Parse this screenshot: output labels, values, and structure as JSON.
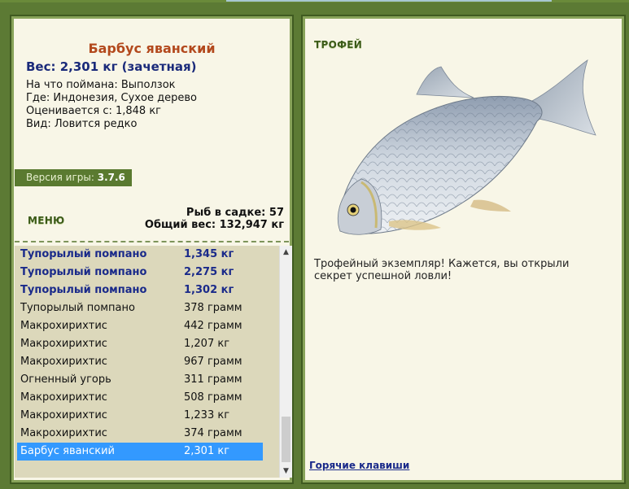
{
  "fish": {
    "title": "Барбус яванский",
    "weight": "Вес: 2,301 кг (зачетная)",
    "details": [
      "На что поймана: Выползок",
      "Где: Индонезия, Сухое дерево",
      "Оценивается с: 1,848 кг",
      "Вид: Ловится редко"
    ]
  },
  "version": {
    "label": "Версия игры:",
    "value": "3.7.6"
  },
  "menu_label": "МЕНЮ",
  "stats": {
    "count": "Рыб в садке: 57",
    "total": "Общий вес: 132,947 кг"
  },
  "catch_list": [
    {
      "name": "Тупорылый помпано",
      "weight": "1,345 кг",
      "style": "bold"
    },
    {
      "name": "Тупорылый помпано",
      "weight": "2,275 кг",
      "style": "bold"
    },
    {
      "name": "Тупорылый помпано",
      "weight": "1,302 кг",
      "style": "bold"
    },
    {
      "name": "Тупорылый помпано",
      "weight": "378 грамм",
      "style": "normal"
    },
    {
      "name": "Макрохирихтис",
      "weight": "442 грамм",
      "style": "normal"
    },
    {
      "name": "Макрохирихтис",
      "weight": "1,207 кг",
      "style": "normal"
    },
    {
      "name": "Макрохирихтис",
      "weight": "967 грамм",
      "style": "normal"
    },
    {
      "name": "Огненный угорь",
      "weight": "311 грамм",
      "style": "normal"
    },
    {
      "name": "Макрохирихтис",
      "weight": "508 грамм",
      "style": "normal"
    },
    {
      "name": "Макрохирихтис",
      "weight": "1,233 кг",
      "style": "normal"
    },
    {
      "name": "Макрохирихтис",
      "weight": "374 грамм",
      "style": "normal"
    },
    {
      "name": "Барбус яванский",
      "weight": "2,301 кг",
      "style": "selected"
    }
  ],
  "trophy": {
    "label": "ТРОФЕЙ",
    "text": "Трофейный экземпляр! Кажется, вы открыли секрет успешной ловли!"
  },
  "hotkeys_label": "Горячие клавиши",
  "icons": {
    "scroll_up": "chevron-up-icon",
    "scroll_down": "chevron-down-icon"
  },
  "colors": {
    "accent": "#5a7a30",
    "title": "#b3491d",
    "link": "#1a2a8a",
    "selection": "#3399ff"
  }
}
